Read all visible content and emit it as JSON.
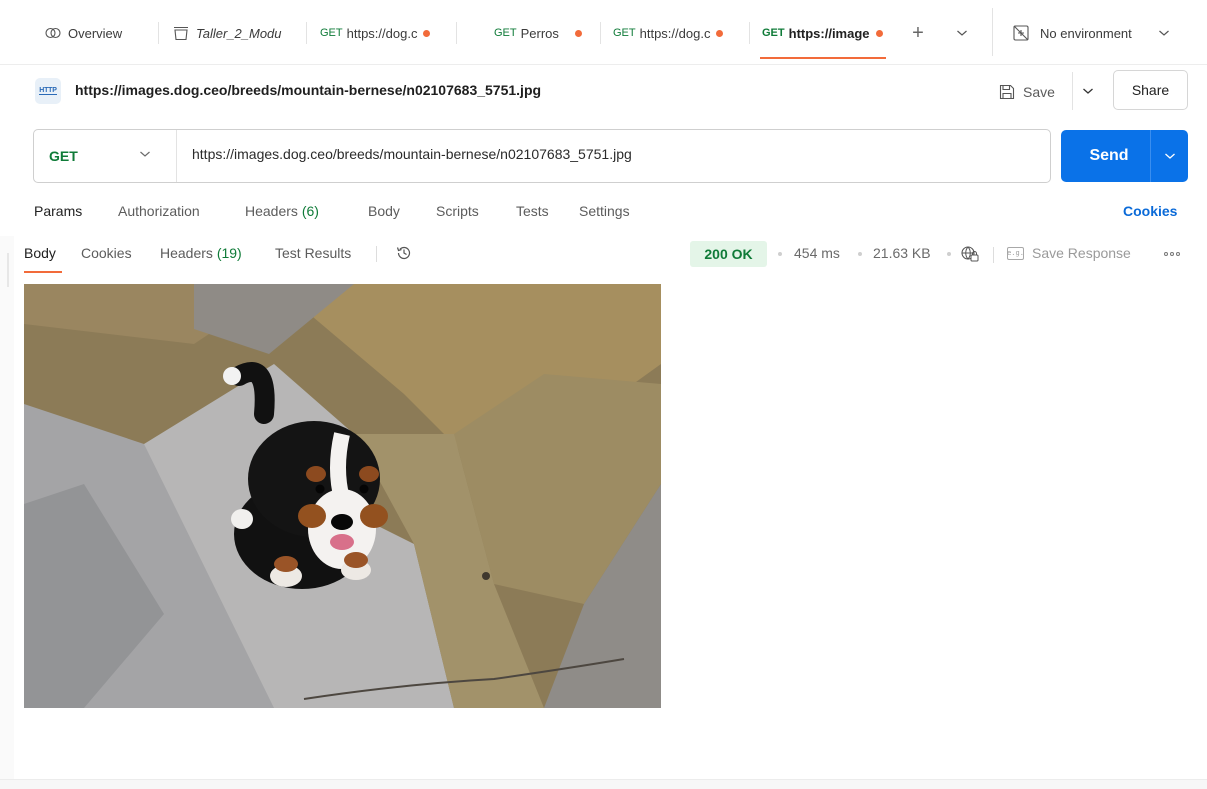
{
  "tabs": [
    {
      "icon": "overview-icon",
      "label": "Overview"
    },
    {
      "icon": "collection-icon",
      "label": "Taller_2_Modu"
    },
    {
      "method": "GET",
      "label": "https://dog.c",
      "unsaved": true
    },
    {
      "method": "GET",
      "label": "Perros",
      "unsaved": true
    },
    {
      "method": "GET",
      "label": "https://dog.c",
      "unsaved": true
    },
    {
      "method": "GET",
      "label": "https://image",
      "unsaved": true,
      "active": true
    }
  ],
  "tabbar": {
    "new_tab": "+",
    "environment": "No environment"
  },
  "request": {
    "title": "https://images.dog.ceo/breeds/mountain-bernese/n02107683_5751.jpg",
    "badge": "HTTP",
    "save_label": "Save",
    "share_label": "Share",
    "method": "GET",
    "url": "https://images.dog.ceo/breeds/mountain-bernese/n02107683_5751.jpg",
    "send_label": "Send"
  },
  "request_tabs": {
    "params": "Params",
    "authorization": "Authorization",
    "headers": "Headers",
    "headers_count": "(6)",
    "body": "Body",
    "scripts": "Scripts",
    "tests": "Tests",
    "settings": "Settings",
    "cookies": "Cookies"
  },
  "response": {
    "tabs": {
      "body": "Body",
      "cookies": "Cookies",
      "headers": "Headers",
      "headers_count": "(19)",
      "test_results": "Test Results"
    },
    "status": "200 OK",
    "time": "454 ms",
    "size": "21.63 KB",
    "save_response": "Save Response"
  },
  "colors": {
    "accent": "#f26b3a",
    "send": "#0a72e8",
    "method_get": "#0f7b38",
    "status_bg": "#e4f5e8"
  }
}
